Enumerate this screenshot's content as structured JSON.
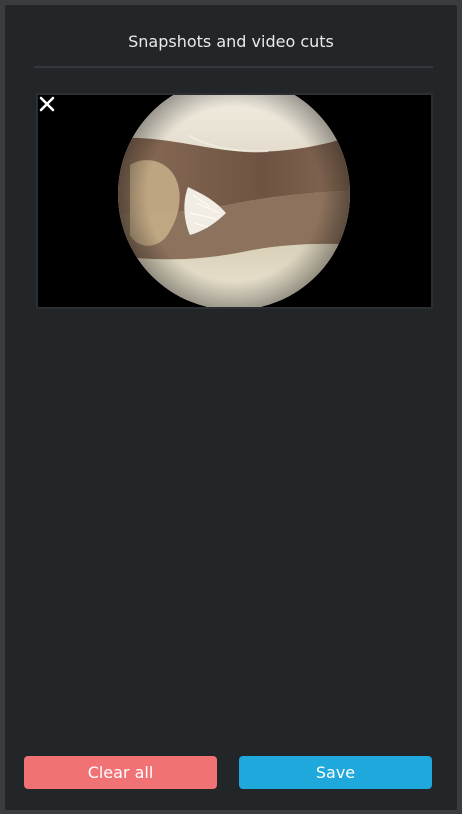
{
  "panel": {
    "title": "Snapshots and video cuts"
  },
  "snapshots": [
    {
      "kind": "image",
      "close_icon": "close-icon"
    }
  ],
  "actions": {
    "clear_label": "Clear all",
    "save_label": "Save"
  },
  "colors": {
    "background": "#232629",
    "clear_button": "#f07274",
    "save_button": "#1fa8dc",
    "title_text": "#e8eaec"
  }
}
